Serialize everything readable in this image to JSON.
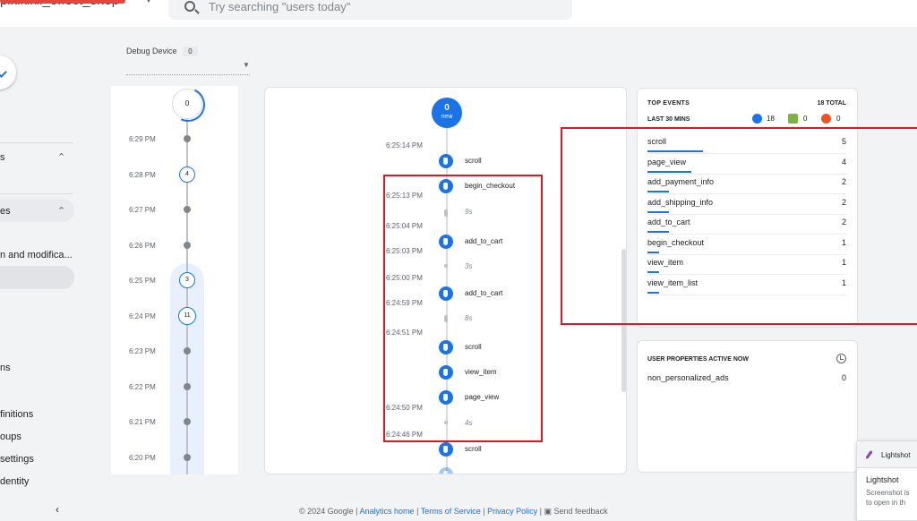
{
  "header": {
    "account_name": "p̶i̶k̶l̶k̶l̶k̶l̶l̶_effect_shop",
    "search_placeholder": "Try searching \"users today\""
  },
  "nav": {
    "items": [
      {
        "label": "s"
      },
      {
        "label": "es"
      },
      {
        "label": "n and modifica..."
      },
      {
        "label": "ns"
      },
      {
        "label": "finitions"
      },
      {
        "label": "oups"
      },
      {
        "label": "settings"
      },
      {
        "label": "dentity"
      }
    ]
  },
  "debug_device": {
    "label": "Debug Device",
    "count": "0"
  },
  "minutes": {
    "top_count": "0",
    "rows": [
      {
        "time": "6:29 PM",
        "count": ""
      },
      {
        "time": "6:28 PM",
        "count": "4"
      },
      {
        "time": "6:27 PM",
        "count": ""
      },
      {
        "time": "6:26 PM",
        "count": ""
      },
      {
        "time": "6:25 PM",
        "count": "3"
      },
      {
        "time": "6:24 PM",
        "count": "11"
      },
      {
        "time": "6:23 PM",
        "count": ""
      },
      {
        "time": "6:22 PM",
        "count": ""
      },
      {
        "time": "6:21 PM",
        "count": ""
      },
      {
        "time": "6:20 PM",
        "count": ""
      }
    ]
  },
  "stream": {
    "new_count": "0",
    "new_label": "new",
    "times": [
      "6:25:14 PM",
      "6:25:13 PM",
      "6:25:04 PM",
      "6:25:03 PM",
      "6:25:00 PM",
      "6:24:59 PM",
      "6:24:51 PM",
      "6:24:50 PM",
      "6:24:46 PM"
    ],
    "events": [
      "scroll",
      "begin_checkout",
      "add_to_cart",
      "add_to_cart",
      "scroll",
      "view_item",
      "page_view",
      "scroll"
    ],
    "gaps": [
      "9s",
      "3s",
      "8s",
      "4s"
    ]
  },
  "top_events": {
    "title": "TOP EVENTS",
    "total": "18 TOTAL",
    "subtitle": "LAST 30 MINS",
    "counts": {
      "events": "18",
      "conversions": "0",
      "errors": "0"
    },
    "rows": [
      {
        "name": "scroll",
        "count": "5",
        "share": 0.28
      },
      {
        "name": "page_view",
        "count": "4",
        "share": 0.22
      },
      {
        "name": "add_payment_info",
        "count": "2",
        "share": 0.11
      },
      {
        "name": "add_shipping_info",
        "count": "2",
        "share": 0.11
      },
      {
        "name": "add_to_cart",
        "count": "2",
        "share": 0.11
      },
      {
        "name": "begin_checkout",
        "count": "1",
        "share": 0.06
      },
      {
        "name": "view_item",
        "count": "1",
        "share": 0.06
      },
      {
        "name": "view_item_list",
        "count": "1",
        "share": 0.06
      }
    ]
  },
  "user_properties": {
    "title": "USER PROPERTIES ACTIVE NOW",
    "rows": [
      {
        "name": "non_personalized_ads",
        "count": "0"
      }
    ]
  },
  "footer": {
    "copyright": "© 2024 Google |",
    "links": [
      "Analytics home",
      "Terms of Service",
      "Privacy Policy"
    ],
    "feedback": "Send feedback"
  },
  "lightshot": {
    "header": "Lightshot",
    "title": "Lightshot",
    "line1": "Screenshot is",
    "line2": "to open in th"
  },
  "colors": {
    "accent": "#1a73e8",
    "annotation_red": "#e0181f",
    "conversion_green": "#7cb342",
    "error_orange": "#f4511e"
  }
}
